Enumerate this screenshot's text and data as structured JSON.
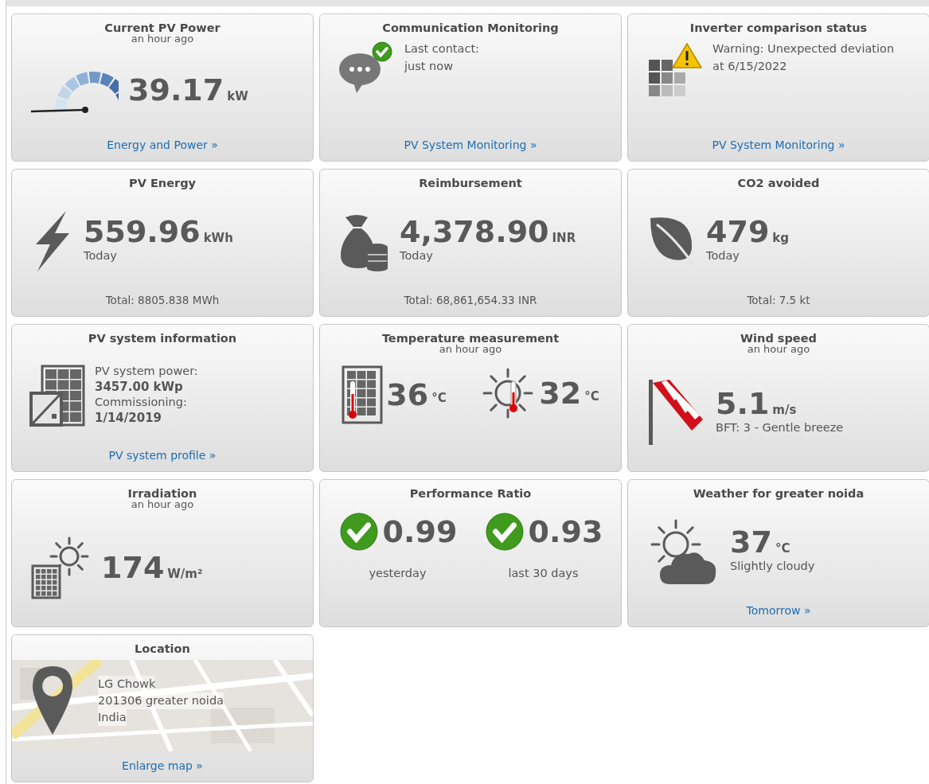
{
  "tiles": [
    {
      "kind": "metric",
      "title": "Current PV Power",
      "subtitle": "an hour ago",
      "value": "39.17",
      "unit": "kW",
      "link": "Energy and Power »"
    },
    {
      "kind": "message",
      "title": "Communication Monitoring",
      "lines": [
        "Last contact:",
        "just now"
      ],
      "link": "PV System Monitoring »"
    },
    {
      "kind": "message",
      "title": "Inverter comparison status",
      "lines": [
        "Warning: Unexpected deviation",
        "at 6/15/2022"
      ],
      "link": "PV System Monitoring »"
    },
    {
      "kind": "metric",
      "title": "PV Energy",
      "value": "559.96",
      "unit": "kWh",
      "note": "Today",
      "total": "Total: 8805.838 MWh"
    },
    {
      "kind": "metric",
      "title": "Reimbursement",
      "value": "4,378.90",
      "unit": "INR",
      "note": "Today",
      "total": "Total: 68,861,654.33 INR"
    },
    {
      "kind": "metric",
      "title": "CO2 avoided",
      "value": "479",
      "unit": "kg",
      "note": "Today",
      "total": "Total: 7.5 kt"
    },
    {
      "kind": "info",
      "title": "PV system information",
      "items": [
        {
          "label": "PV system power:",
          "value": "3457.00 kWp"
        },
        {
          "label": "Commissioning:",
          "value": "1/14/2019"
        }
      ],
      "link": "PV system profile »"
    },
    {
      "kind": "pair",
      "title": "Temperature measurement",
      "subtitle": "an hour ago",
      "readings": [
        {
          "value": "36",
          "unit": "°C"
        },
        {
          "value": "32",
          "unit": "°C"
        }
      ]
    },
    {
      "kind": "metric",
      "title": "Wind speed",
      "subtitle": "an hour ago",
      "value": "5.1",
      "unit": "m/s",
      "note": "BFT: 3 - Gentle breeze"
    },
    {
      "kind": "metric",
      "title": "Irradiation",
      "subtitle": "an hour ago",
      "value": "174",
      "unit": "W/m²"
    },
    {
      "kind": "pair",
      "title": "Performance Ratio",
      "readings": [
        {
          "value": "0.99",
          "label": "yesterday"
        },
        {
          "value": "0.93",
          "label": "last 30 days"
        }
      ]
    },
    {
      "kind": "metric",
      "title": "Weather for greater noida",
      "value": "37",
      "unit": "°C",
      "note": "Slightly cloudy",
      "link": "Tomorrow »"
    },
    {
      "kind": "location",
      "title": "Location",
      "lines": [
        "LG Chowk",
        "201306 greater noida",
        "India"
      ],
      "link": "Enlarge map »"
    }
  ]
}
